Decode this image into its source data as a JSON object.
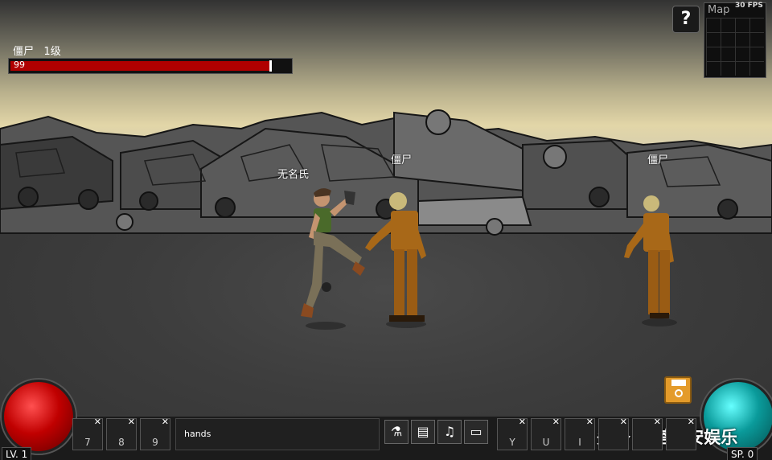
{
  "boss": {
    "name": "僵尸",
    "level": "1级",
    "hp_text": "99",
    "hp_fraction": 0.93
  },
  "help_button": {
    "label": "?"
  },
  "minimap": {
    "label": "Map",
    "fps": "30 FPS"
  },
  "units": {
    "player_name": "无名氏",
    "enemy1_name": "僵尸",
    "enemy2_name": "僵尸"
  },
  "hotbar_left": [
    {
      "key": "7",
      "close": "✕"
    },
    {
      "key": "8",
      "close": "✕"
    },
    {
      "key": "9",
      "close": "✕"
    }
  ],
  "weapon": {
    "name": "hands"
  },
  "menu_buttons": [
    {
      "icon": "potion-icon",
      "glyph": "⚗"
    },
    {
      "icon": "document-icon",
      "glyph": "▤"
    },
    {
      "icon": "music-icon",
      "glyph": "♫"
    },
    {
      "icon": "monitor-icon",
      "glyph": "▭"
    }
  ],
  "hotbar_right": [
    {
      "key": "Y",
      "close": "✕"
    },
    {
      "key": "U",
      "close": "✕"
    },
    {
      "key": "I",
      "close": "✕"
    },
    {
      "key": "",
      "close": "✕"
    },
    {
      "key": "",
      "close": "✕"
    },
    {
      "key": "",
      "close": "✕"
    }
  ],
  "status": {
    "level_text": "LV. 1",
    "sp_text": "SP.  0"
  },
  "watermark": "头条 @塔斯安娱乐",
  "colors": {
    "hp_bar": "#b00000",
    "hp_orb": "#c00000",
    "sp_orb": "#0a9a9a",
    "save": "#e49b2a"
  }
}
